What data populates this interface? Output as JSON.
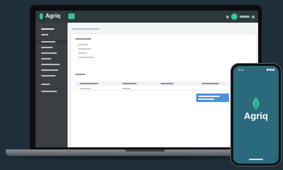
{
  "app": {
    "brand_name": "Agriq",
    "brand_icon": "leaf-icon",
    "brand_color": "#38c793"
  },
  "phone": {
    "app_name": "Agriq",
    "status_time": "9:41",
    "background_color": "#2b6a7c"
  },
  "colors": {
    "backdrop": "#1f2f3a",
    "topbar": "#2c3a3c",
    "sidebar": "#3b3e42",
    "dropdown": "#4a90e2"
  }
}
